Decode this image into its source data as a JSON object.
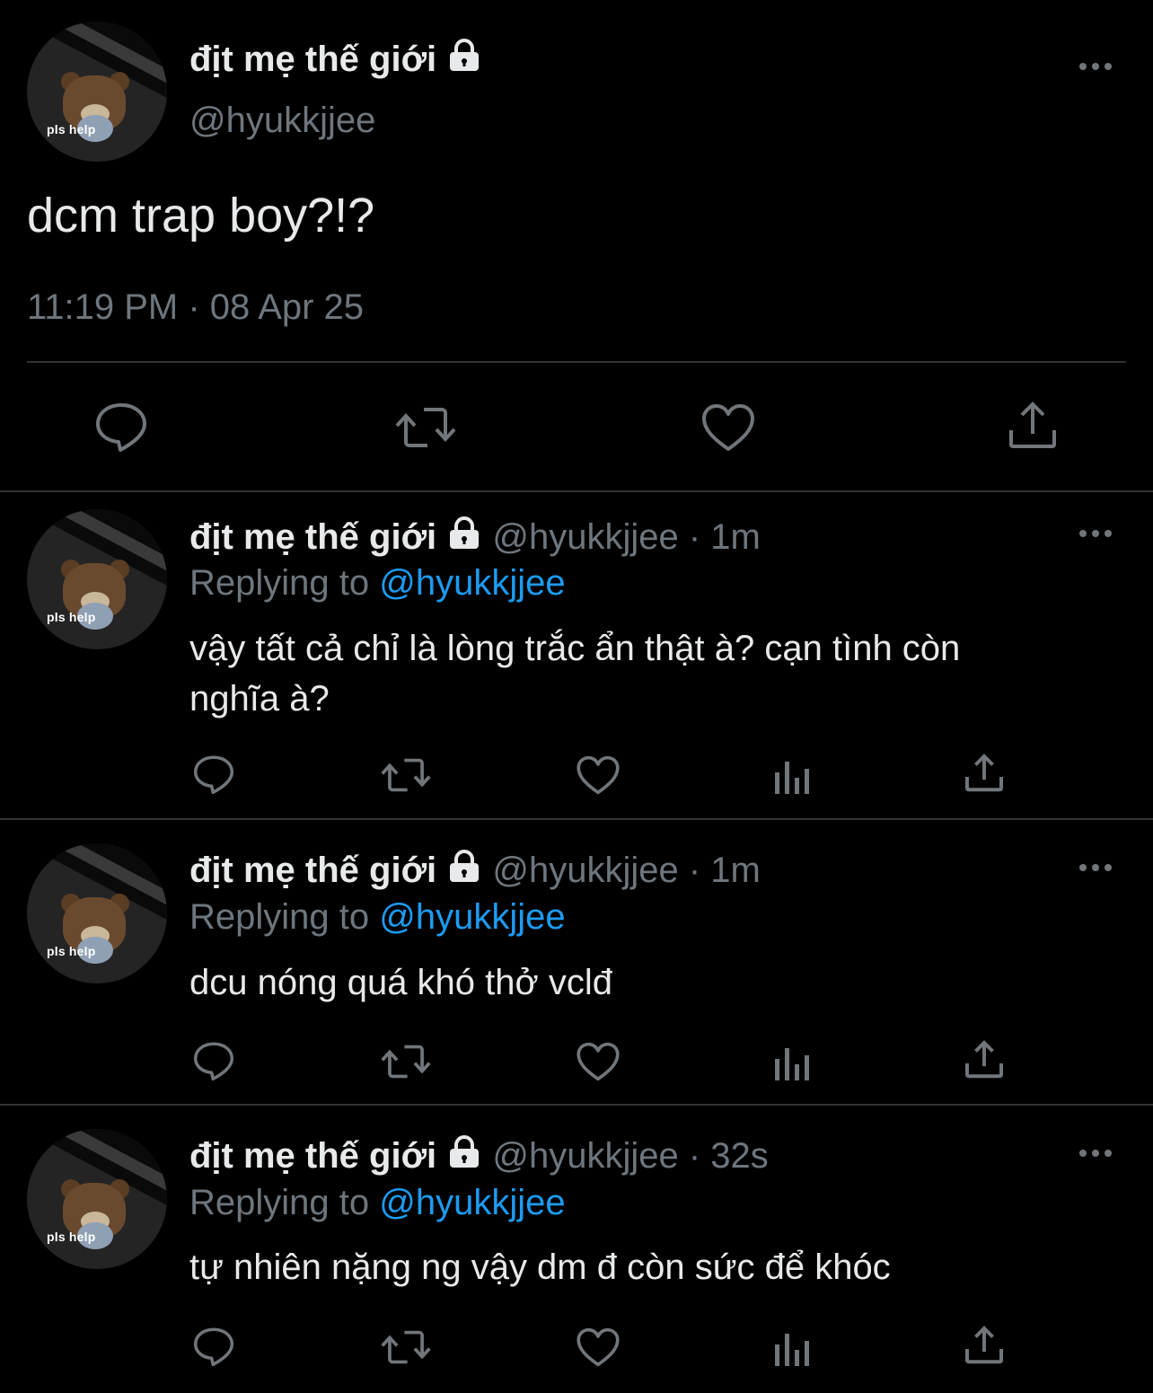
{
  "main_tweet": {
    "display_name": "địt mẹ thế giới",
    "handle": "@hyukkjjee",
    "avatar_caption": "pls help",
    "text": "dcm trap boy?!?",
    "timestamp": "11:19 PM · 08 Apr 25",
    "actions": [
      "reply-icon",
      "retweet-icon",
      "like-icon",
      "share-icon"
    ]
  },
  "replies": [
    {
      "display_name": "địt mẹ thế giới",
      "handle": "@hyukkjjee",
      "time": "1m",
      "replying_prefix": "Replying to ",
      "replying_handle": "@hyukkjjee",
      "avatar_caption": "pls help",
      "text_line1": "vậy tất cả chỉ là lòng trắc ẩn thật à? cạn tình còn",
      "text_line2": "nghĩa à?"
    },
    {
      "display_name": "địt mẹ thế giới",
      "handle": "@hyukkjjee",
      "time": "1m",
      "replying_prefix": "Replying to ",
      "replying_handle": "@hyukkjjee",
      "avatar_caption": "pls help",
      "text_line1": "dcu nóng quá khó thở vclđ",
      "text_line2": ""
    },
    {
      "display_name": "địt mẹ thế giới",
      "handle": "@hyukkjjee",
      "time": "32s",
      "replying_prefix": "Replying to ",
      "replying_handle": "@hyukkjjee",
      "avatar_caption": "pls help",
      "text_line1": "tự nhiên nặng ng vậy dm đ còn sức để khóc",
      "text_line2": ""
    }
  ],
  "icons": [
    "lock-icon",
    "more-icon",
    "reply-icon",
    "retweet-icon",
    "like-icon",
    "analytics-icon",
    "share-icon"
  ],
  "colors": {
    "background": "#000000",
    "text": "#e7e9ea",
    "muted": "#6e767d",
    "link": "#1d9bf0",
    "divider": "#2f3336"
  }
}
